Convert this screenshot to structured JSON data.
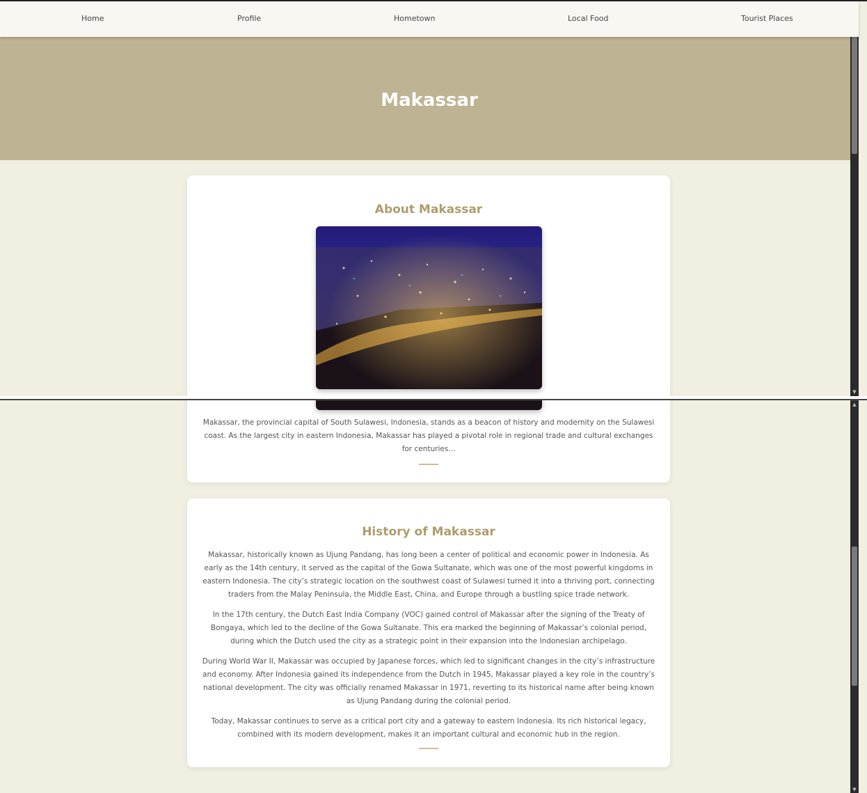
{
  "nav": {
    "items": [
      {
        "label": "Home"
      },
      {
        "label": "Profile"
      },
      {
        "label": "Hometown"
      },
      {
        "label": "Local Food"
      },
      {
        "label": "Tourist Places"
      }
    ]
  },
  "hero": {
    "title": "Makassar"
  },
  "about": {
    "title": "About Makassar",
    "image_icon": "city-night-aerial-photo",
    "text": "Makassar, the provincial capital of South Sulawesi, Indonesia, stands as a beacon of history and modernity on the Sulawesi coast. As the largest city in eastern Indonesia, Makassar has played a pivotal role in regional trade and cultural exchanges for centuries..."
  },
  "history": {
    "title": "History of Makassar",
    "paragraphs": [
      "Makassar, historically known as Ujung Pandang, has long been a center of political and economic power in Indonesia. As early as the 14th century, it served as the capital of the Gowa Sultanate, which was one of the most powerful kingdoms in eastern Indonesia. The city’s strategic location on the southwest coast of Sulawesi turned it into a thriving port, connecting traders from the Malay Peninsula, the Middle East, China, and Europe through a bustling spice trade network.",
      "In the 17th century, the Dutch East India Company (VOC) gained control of Makassar after the signing of the Treaty of Bongaya, which led to the decline of the Gowa Sultanate. This era marked the beginning of Makassar’s colonial period, during which the Dutch used the city as a strategic point in their expansion into the Indonesian archipelago.",
      "During World War II, Makassar was occupied by Japanese forces, which led to significant changes in the city’s infrastructure and economy. After Indonesia gained its independence from the Dutch in 1945, Makassar played a key role in the country’s national development. The city was officially renamed Makassar in 1971, reverting to its historical name after being known as Ujung Pandang during the colonial period.",
      "Today, Makassar continues to serve as a critical port city and a gateway to eastern Indonesia. Its rich historical legacy, combined with its modern development, makes it an important cultural and economic hub in the region."
    ]
  },
  "colors": {
    "hero_bg": "#beb493",
    "accent": "#ad9d6c",
    "page_bg": "#f1eee2",
    "nav_bg": "#f9f7f1"
  }
}
